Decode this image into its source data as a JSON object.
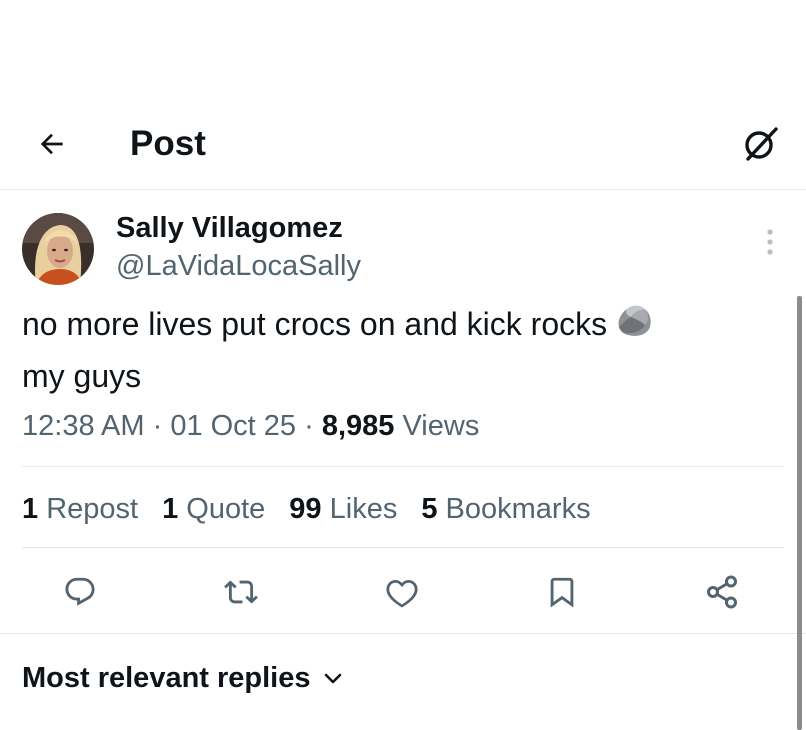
{
  "header": {
    "back_icon": "arrow-left-icon",
    "title": "Post",
    "grok_icon": "grok-icon"
  },
  "post": {
    "author": {
      "display_name": "Sally Villagomez",
      "handle": "@LaVidaLocaSally"
    },
    "text_line1": "no more lives put crocs on and kick rocks",
    "text_line2": "my guys",
    "emoji": "rock-emoji",
    "time": "12:38 AM",
    "separator": " · ",
    "date": "01 Oct 25",
    "views_count": "8,985",
    "views_label": "Views"
  },
  "stats": {
    "reposts_count": "1",
    "reposts_label": "Repost",
    "quotes_count": "1",
    "quotes_label": "Quote",
    "likes_count": "99",
    "likes_label": "Likes",
    "bookmarks_count": "5",
    "bookmarks_label": "Bookmarks"
  },
  "actions": [
    "reply-icon",
    "repost-icon",
    "like-icon",
    "bookmark-icon",
    "share-icon"
  ],
  "replies": {
    "sort_label": "Most relevant replies"
  },
  "colors": {
    "text": "#0f1419",
    "secondary": "#536471",
    "divider": "#e6e9eb"
  }
}
